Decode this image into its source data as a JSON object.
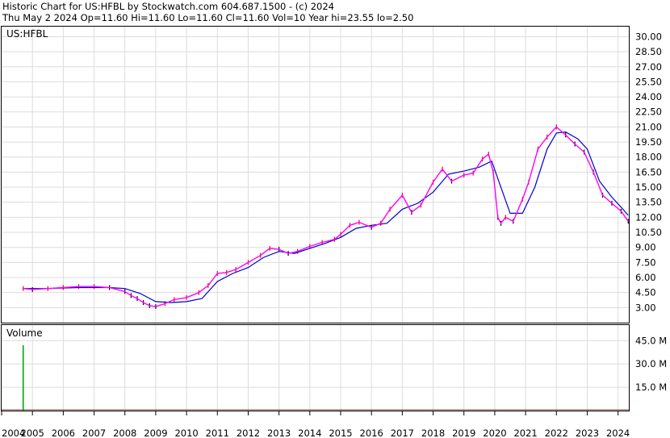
{
  "header": {
    "line1": "Historic Chart for US:HFBL by Stockwatch.com 604.687.1500 - (c) 2024",
    "line2": "Thu May  2 2024  Op=11.60  Hi=11.60  Lo=11.60  Cl=11.60  Vol=10  Year hi=23.55  lo=2.50"
  },
  "colors": {
    "price_bar_up": "#ff0000",
    "price_bar_down": "#000000",
    "ma_short": "#ff00ff",
    "ma_long": "#0000cc",
    "volume": "#00aa00",
    "grid": "#dcdcdc"
  },
  "chart_data": [
    {
      "type": "line",
      "title": "US:HFBL",
      "xlabel": "",
      "ylabel": "",
      "grid": true,
      "y_axis_side": "right",
      "ylim": [
        1.5,
        31.0
      ],
      "y_ticks": [
        "3.00",
        "4.50",
        "6.00",
        "7.50",
        "9.00",
        "10.50",
        "12.00",
        "13.50",
        "15.00",
        "16.50",
        "18.00",
        "19.50",
        "21.00",
        "22.50",
        "24.00",
        "25.50",
        "27.00",
        "28.50",
        "30.00"
      ],
      "x_ticks": [
        "2004",
        "2005",
        "2006",
        "2007",
        "2008",
        "2009",
        "2010",
        "2011",
        "2012",
        "2013",
        "2014",
        "2015",
        "2016",
        "2017",
        "2018",
        "2019",
        "2020",
        "2021",
        "2022",
        "2023",
        "2024"
      ],
      "xlim": [
        2004.0,
        2024.35
      ],
      "series": [
        {
          "x": [
            2004.7,
            2005.0,
            2005.5,
            2006.0,
            2006.5,
            2007.0,
            2007.5,
            2008.0,
            2008.2,
            2008.4,
            2008.6,
            2008.8,
            2009.0,
            2009.3,
            2009.6,
            2010.0,
            2010.4,
            2010.7,
            2011.0,
            2011.3,
            2011.6,
            2012.0,
            2012.4,
            2012.7,
            2013.0,
            2013.3,
            2013.6,
            2014.0,
            2014.4,
            2014.8,
            2015.0,
            2015.3,
            2015.6,
            2016.0,
            2016.3,
            2016.6,
            2017.0,
            2017.3,
            2017.6,
            2018.0,
            2018.3,
            2018.6,
            2019.0,
            2019.3,
            2019.6,
            2019.8,
            2019.95,
            2020.1,
            2020.2,
            2020.35,
            2020.6,
            2020.9,
            2021.1,
            2021.4,
            2021.7,
            2022.0,
            2022.3,
            2022.6,
            2022.9,
            2023.2,
            2023.5,
            2023.8,
            2024.1,
            2024.33
          ],
          "values": [
            4.9,
            4.8,
            4.9,
            5.0,
            5.1,
            5.1,
            5.0,
            4.6,
            4.2,
            3.9,
            3.5,
            3.2,
            3.1,
            3.4,
            3.8,
            4.0,
            4.5,
            5.2,
            6.4,
            6.5,
            6.8,
            7.5,
            8.2,
            8.9,
            8.8,
            8.4,
            8.6,
            9.1,
            9.5,
            9.8,
            10.3,
            11.2,
            11.5,
            11.0,
            11.4,
            12.8,
            14.2,
            12.5,
            13.2,
            15.5,
            16.8,
            15.6,
            16.2,
            16.4,
            17.8,
            18.3,
            16.5,
            12.0,
            11.4,
            12.0,
            11.6,
            13.8,
            15.5,
            18.8,
            20.0,
            21.0,
            20.2,
            19.3,
            18.5,
            16.5,
            14.2,
            13.4,
            12.6,
            11.6
          ]
        },
        {
          "x": [
            2004.7,
            2005.5,
            2006.5,
            2007.5,
            2008.0,
            2008.5,
            2009.0,
            2009.5,
            2010.0,
            2010.5,
            2011.0,
            2011.5,
            2012.0,
            2012.5,
            2013.0,
            2013.5,
            2014.0,
            2014.5,
            2015.0,
            2015.5,
            2016.0,
            2016.5,
            2017.0,
            2017.5,
            2018.0,
            2018.5,
            2019.0,
            2019.5,
            2019.9,
            2020.2,
            2020.5,
            2020.9,
            2021.3,
            2021.7,
            2022.0,
            2022.3,
            2022.7,
            2023.0,
            2023.4,
            2023.8,
            2024.1,
            2024.33
          ],
          "values": [
            4.9,
            4.9,
            5.0,
            5.0,
            4.9,
            4.4,
            3.6,
            3.5,
            3.6,
            3.9,
            5.6,
            6.4,
            7.0,
            8.0,
            8.6,
            8.4,
            8.9,
            9.4,
            10.0,
            10.9,
            11.2,
            11.4,
            12.8,
            13.4,
            14.5,
            16.3,
            16.6,
            17.0,
            17.6,
            15.0,
            12.4,
            12.4,
            15.0,
            18.8,
            20.4,
            20.5,
            19.8,
            18.8,
            15.6,
            14.0,
            13.0,
            12.2
          ]
        }
      ]
    },
    {
      "type": "bar",
      "title": "Volume",
      "y_axis_side": "right",
      "ylim": [
        0,
        55000000
      ],
      "y_ticks": [
        "15.0 M",
        "30.0 M",
        "45.0 M"
      ],
      "series": [
        {
          "x": [
            2004.7
          ],
          "values": [
            42000000
          ]
        }
      ]
    }
  ]
}
